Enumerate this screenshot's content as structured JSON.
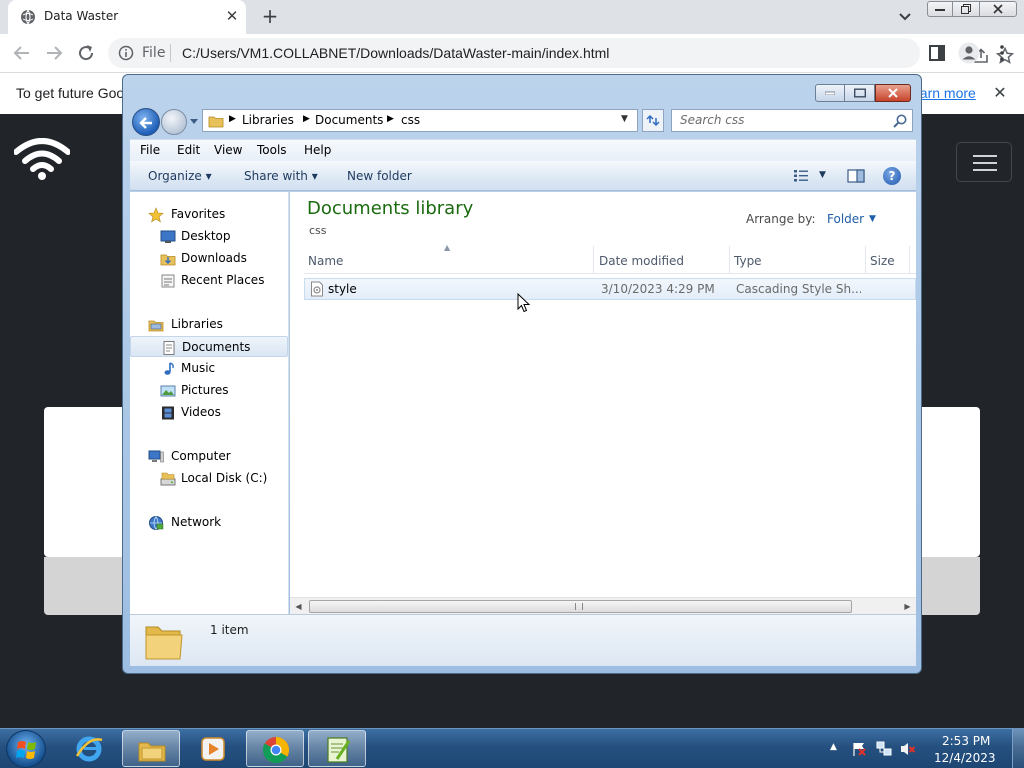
{
  "chrome": {
    "tab_title": "Data Waster",
    "tab_close": "✕",
    "new_tab": "+",
    "omnibox_scheme": "File",
    "url": "C:/Users/VM1.COLLABNET/Downloads/DataWaster-main/index.html",
    "infobar_text": "To get future Goog",
    "infobar_link": "earn more",
    "infobar_close": "✕"
  },
  "explorer": {
    "breadcrumb": [
      "Libraries",
      "Documents",
      "css"
    ],
    "search_placeholder": "Search css",
    "menu": [
      "File",
      "Edit",
      "View",
      "Tools",
      "Help"
    ],
    "commands": {
      "organize": "Organize ▾",
      "share_with": "Share with ▾",
      "new_folder": "New folder"
    },
    "help_label": "?",
    "nav": {
      "favorites": "Favorites",
      "desktop": "Desktop",
      "downloads": "Downloads",
      "recent_places": "Recent Places",
      "libraries": "Libraries",
      "documents": "Documents",
      "music": "Music",
      "pictures": "Pictures",
      "videos": "Videos",
      "computer": "Computer",
      "local_disk": "Local Disk (C:)",
      "network": "Network"
    },
    "library_title": "Documents library",
    "library_subtitle": "css",
    "arrange_label": "Arrange by:",
    "arrange_value": "Folder",
    "columns": [
      "Name",
      "Date modified",
      "Type",
      "Size"
    ],
    "files": [
      {
        "name": "style",
        "date": "3/10/2023 4:29 PM",
        "type": "Cascading Style Sh..."
      }
    ],
    "item_count": "1 item"
  },
  "taskbar": {
    "clock_time": "2:53 PM",
    "clock_date": "12/4/2023"
  },
  "colors": {
    "library_title": "#1a6b0f",
    "link": "#1a73e8",
    "page_bg": "#212529"
  }
}
